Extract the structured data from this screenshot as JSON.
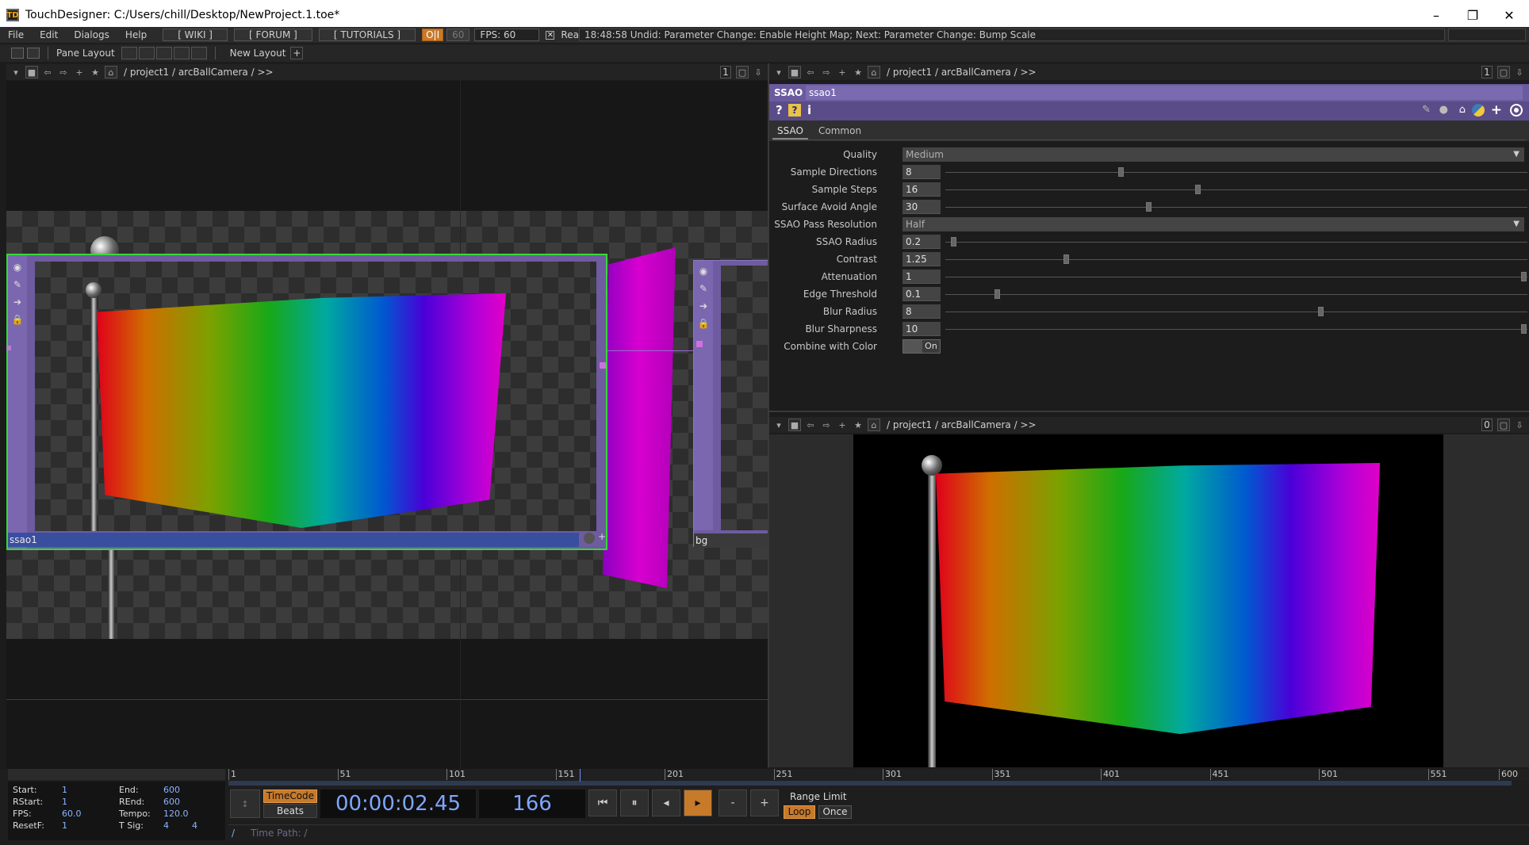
{
  "window": {
    "title": "TouchDesigner: C:/Users/chill/Desktop/NewProject.1.toe*",
    "minimize": "–",
    "restore": "❐",
    "close": "✕"
  },
  "menu": {
    "file": "File",
    "edit": "Edit",
    "dialogs": "Dialogs",
    "help": "Help",
    "wiki": "[ WIKI ]",
    "forum": "[ FORUM ]",
    "tutorials": "[ TUTORIALS ]",
    "oi": "O|I",
    "sixty": "60",
    "fps": "FPS:  60",
    "realtime": "Realtime",
    "undo": "18:48:58 Undid: Parameter Change: Enable Height Map; Next: Parameter Change: Bump Scale"
  },
  "panebar": {
    "pane_layout": "Pane Layout",
    "new_layout": "New Layout"
  },
  "left_pane": {
    "path": "/  project1  /  arcBallCamera  /  >>",
    "count": "1",
    "node_main": "ssao1",
    "node_bg": "bg"
  },
  "param_pane": {
    "path": "/  project1  /  arcBallCamera  /  >>",
    "count": "1",
    "op_type": "SSAO",
    "op_name": "ssao1",
    "tabs": [
      "SSAO",
      "Common"
    ]
  },
  "params": [
    {
      "label": "Quality",
      "value": "Medium",
      "kind": "menu"
    },
    {
      "label": "Sample Directions",
      "value": "8",
      "kind": "slider",
      "pos": 0.3
    },
    {
      "label": "Sample Steps",
      "value": "16",
      "kind": "slider",
      "pos": 0.433
    },
    {
      "label": "Surface Avoid Angle",
      "value": "30",
      "kind": "slider",
      "pos": 0.348
    },
    {
      "label": "SSAO Pass Resolution",
      "value": "Half",
      "kind": "menu"
    },
    {
      "label": "SSAO Radius",
      "value": "0.2",
      "kind": "slider",
      "pos": 0.01
    },
    {
      "label": "Contrast",
      "value": "1.25",
      "kind": "slider",
      "pos": 0.205
    },
    {
      "label": "Attenuation",
      "value": "1",
      "kind": "slider",
      "pos": 0.997
    },
    {
      "label": "Edge Threshold",
      "value": "0.1",
      "kind": "slider",
      "pos": 0.085
    },
    {
      "label": "Blur Radius",
      "value": "8",
      "kind": "slider",
      "pos": 0.645
    },
    {
      "label": "Blur Sharpness",
      "value": "10",
      "kind": "slider",
      "pos": 0.997
    },
    {
      "label": "Combine with Color",
      "value": "On",
      "kind": "toggle"
    }
  ],
  "viewer_pane": {
    "path": "/  project1  /  arcBallCamera  /  >>",
    "count": "0"
  },
  "timeline": {
    "ruler": [
      "1",
      "51",
      "101",
      "151",
      "201",
      "251",
      "301",
      "351",
      "401",
      "451",
      "501",
      "551",
      "600"
    ],
    "stats": {
      "start_l": "Start:",
      "start_v": "1",
      "end_l": "End:",
      "end_v": "600",
      "rstart_l": "RStart:",
      "rstart_v": "1",
      "rend_l": "REnd:",
      "rend_v": "600",
      "fps_l": "FPS:",
      "fps_v": "60.0",
      "tempo_l": "Tempo:",
      "tempo_v": "120.0",
      "resetf_l": "ResetF:",
      "resetf_v": "1",
      "tsig_l": "T Sig:",
      "tsig_a": "4",
      "tsig_b": "4"
    },
    "timecode_btn": "TimeCode",
    "beats_btn": "Beats",
    "timecode": "00:00:02.45",
    "frame": "166",
    "range_limit": "Range Limit",
    "loop": "Loop",
    "once": "Once",
    "timepath": "Time Path: /",
    "slash": "/",
    "playhead": 0.274
  }
}
